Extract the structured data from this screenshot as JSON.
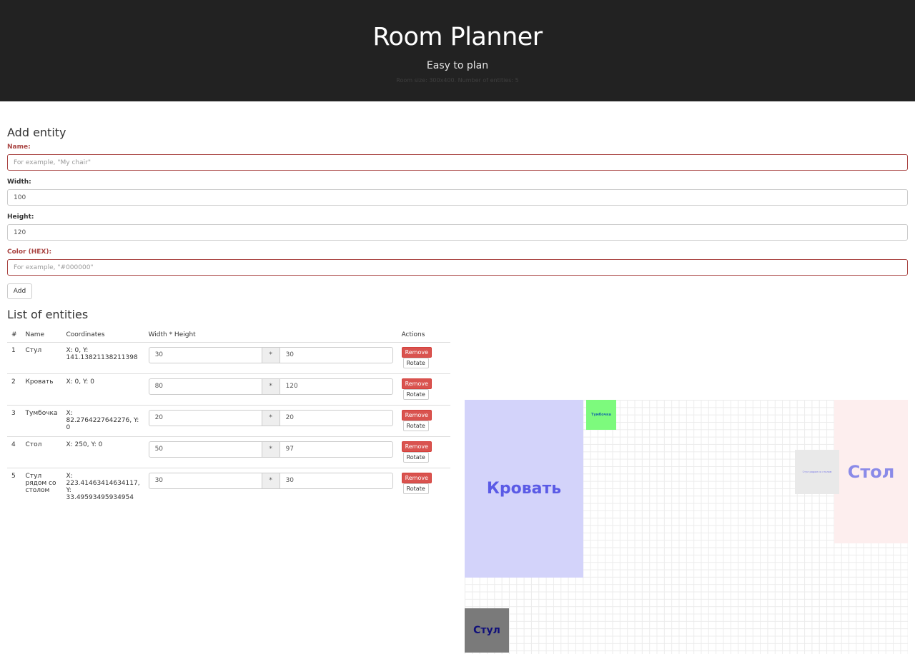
{
  "header": {
    "title": "Room Planner",
    "subtitle": "Easy to plan",
    "info": "Room size: 300x400. Number of entities: 5"
  },
  "add_form": {
    "title": "Add entity",
    "name_label": "Name:",
    "name_placeholder": "For example, \"My chair\"",
    "width_label": "Width:",
    "width_value": "100",
    "height_label": "Height:",
    "height_value": "120",
    "color_label": "Color (HEX):",
    "color_placeholder": "For example, \"#000000\"",
    "add_label": "Add"
  },
  "list": {
    "title": "List of entities",
    "columns": [
      "#",
      "Name",
      "Coordinates",
      "Width * Height",
      "Actions"
    ],
    "separator": "*",
    "remove_label": "Remove",
    "rotate_label": "Rotate",
    "rows": [
      {
        "num": "1",
        "name": "Стул",
        "coords": "X: 0, Y: 141.13821138211398",
        "width": "30",
        "height": "30"
      },
      {
        "num": "2",
        "name": "Кровать",
        "coords": "X: 0, Y: 0",
        "width": "80",
        "height": "120"
      },
      {
        "num": "3",
        "name": "Тумбочка",
        "coords": "X: 82.2764227642276, Y: 0",
        "width": "20",
        "height": "20"
      },
      {
        "num": "4",
        "name": "Стол",
        "coords": "X: 250, Y: 0",
        "width": "50",
        "height": "97"
      },
      {
        "num": "5",
        "name": "Стул рядом со столом",
        "coords": "X: 223.41463414634117, Y: 33.49593495934954",
        "width": "30",
        "height": "30"
      }
    ]
  },
  "plan": {
    "entities": [
      {
        "label": "Кровать",
        "color": "#d3d3fa",
        "text_color": "#5a5ae6"
      },
      {
        "label": "Тумбочка",
        "color": "#7dfa7d",
        "text_color": "#1a6fa3"
      },
      {
        "label": "Стол",
        "color": "#fdeeee",
        "text_color": "#8a8ae8"
      },
      {
        "label": "Стул рядом со столом",
        "color": "#e9e9e9",
        "text_color": "#7a7ae8"
      },
      {
        "label": "Стул",
        "color": "#7a7a7a",
        "text_color": "#10107a"
      }
    ]
  }
}
